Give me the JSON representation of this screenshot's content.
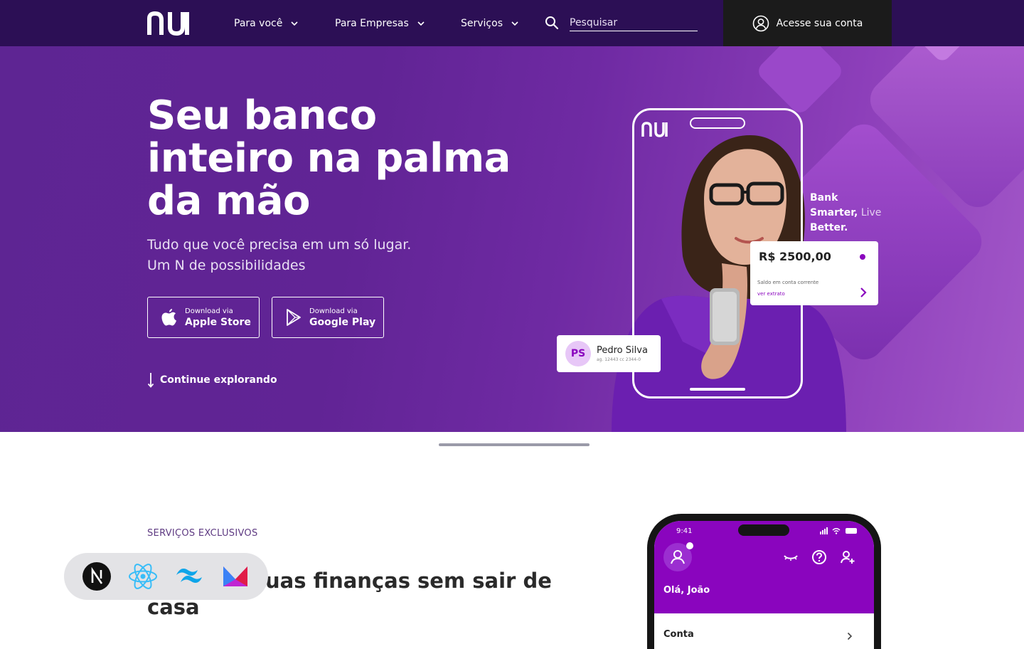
{
  "nav": {
    "logo": "nu",
    "items": [
      {
        "label": "Para você"
      },
      {
        "label": "Para Empresas"
      },
      {
        "label": "Serviços"
      }
    ],
    "search_placeholder": "Pesquisar",
    "login_label": "Acesse sua conta"
  },
  "hero": {
    "title_line1": "Seu banco",
    "title_line2": "inteiro na palma",
    "title_line3": "da mão",
    "subtitle_line1": "Tudo que você precisa em um só lugar.",
    "subtitle_line2": "Um N de possibilidades",
    "apple": {
      "small": "Download via",
      "big": "Apple Store"
    },
    "google": {
      "small": "Download via",
      "big": "Google Play"
    },
    "explore_label": "Continue explorando",
    "phone_logo": "nu",
    "tagline_line1": "Bank",
    "tagline_line2_bold": "Smarter,",
    "tagline_line2_thin": " Live",
    "tagline_line3": "Better.",
    "balance": {
      "amount": "R$ 2500,00",
      "label": "Saldo em conta corrente",
      "link": "ver extrato"
    },
    "user": {
      "initials": "PS",
      "name": "Pedro Silva",
      "account": "ag. 12443  cc 2344-0"
    }
  },
  "section2": {
    "eyebrow": "SERVIÇOS EXCLUSIVOS",
    "title_visible": "uas finanças sem sair de",
    "title_line2": "casa"
  },
  "phone_mock": {
    "time": "9:41",
    "greeting": "Olá, João",
    "account_label": "Conta"
  },
  "tech_icons": [
    "nextjs-icon",
    "react-icon",
    "tailwind-icon",
    "motion-icon"
  ],
  "colors": {
    "nav_bg": "#2c0f55",
    "login_bg": "#1b1b1b",
    "brand_purple": "#8a05be",
    "hero_start": "#5e2593",
    "hero_end": "#a257c8"
  }
}
